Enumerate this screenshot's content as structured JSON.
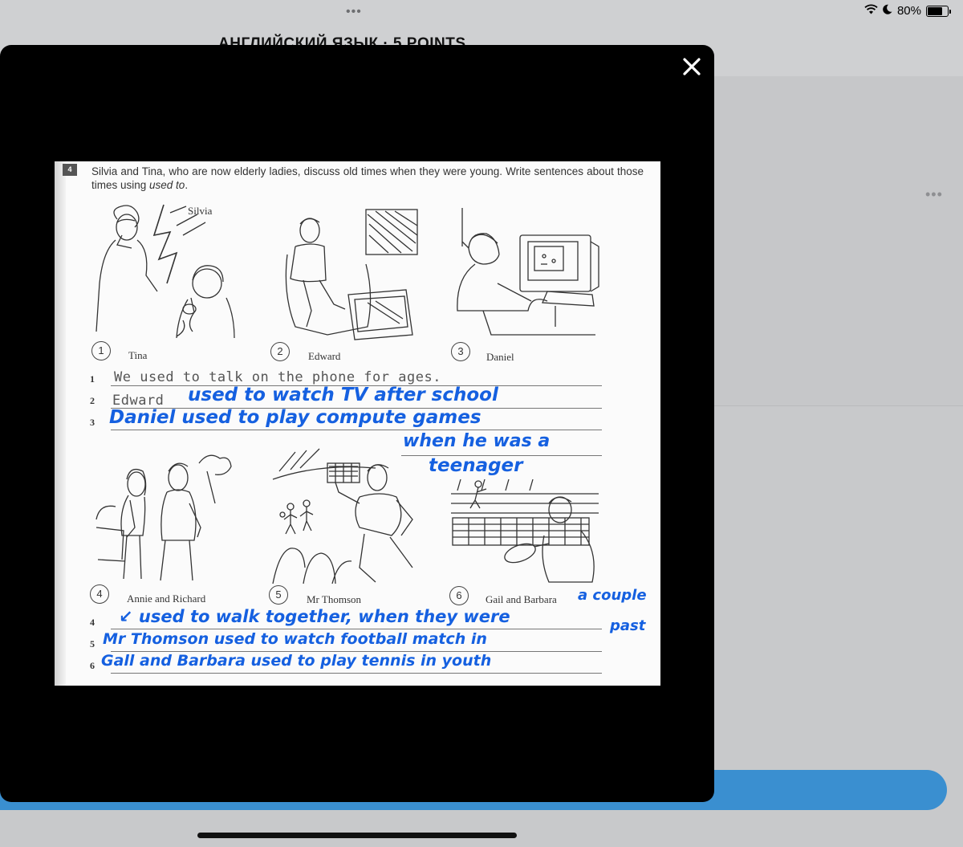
{
  "status_bar": {
    "dots": "•••",
    "battery_pct": "80%",
    "battery_level": 0.8
  },
  "background": {
    "title": "АНГЛИЙСКИЙ ЯЗЫК · 5 POINTS",
    "more": "•••"
  },
  "modal": {
    "close_label": "✕"
  },
  "worksheet": {
    "task_number": "4",
    "instruction_a": "Silvia and Tina, who are now elderly ladies, discuss old times when they were young. Write sentences about those times using ",
    "instruction_em": "used to",
    "instruction_b": ".",
    "label_silvia": "Silvia",
    "pictures": [
      {
        "num": "1",
        "caption": "Tina"
      },
      {
        "num": "2",
        "caption": "Edward"
      },
      {
        "num": "3",
        "caption": "Daniel"
      },
      {
        "num": "4",
        "caption": "Annie and Richard"
      },
      {
        "num": "5",
        "caption": "Mr Thomson"
      },
      {
        "num": "6",
        "caption": "Gail and Barbara"
      }
    ],
    "line_numbers": [
      "1",
      "2",
      "3",
      "4",
      "5",
      "6"
    ],
    "printed_example": "We used to talk on the phone for ages.",
    "printed_edward": "Edward",
    "handwriting": {
      "line2": "used to watch TV after school",
      "line3": "Daniel used to play compute games",
      "line3b": "when he was a",
      "line3c": "teenager",
      "line4_extra": "a couple",
      "line4": "↙ used to walk together, when they were",
      "line5_extra": "past",
      "line5": "Mr Thomson used to watch football match in",
      "line6": "Gall and Barbara used to play tennis in youth"
    }
  }
}
